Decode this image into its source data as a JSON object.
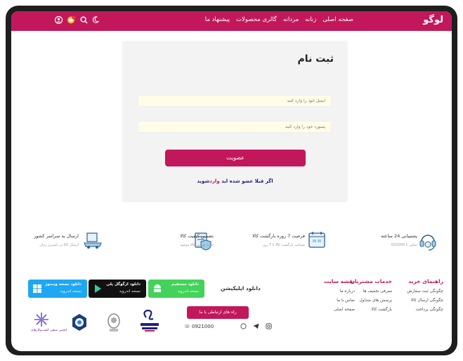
{
  "header": {
    "logo": "لوگو",
    "nav": [
      "صفحه اصلی",
      "زنانه",
      "مردانه",
      "گالری محصولات",
      "پیشنهاد ما"
    ],
    "icons": [
      "user-icon",
      "cart-icon",
      "search-icon",
      "moon-icon"
    ],
    "color": "#c2185b"
  },
  "register": {
    "title": "ثبت نام",
    "email_placeholder": "ایمیل خود را وارد کنید",
    "password_placeholder": "پسورد خود را وارد کنید",
    "submit": "عضویت",
    "login_prefix": "اگر قبلا عضو شده اید",
    "login_link": "وارد",
    "login_suffix": "شوید"
  },
  "features": [
    {
      "title": "پشتیبانی 24 ساعته",
      "subtitle": "تماس با 021000",
      "icon": "headset-icon"
    },
    {
      "title": "فرصت 7 روزه بازگشت کالا",
      "subtitle": "ضمانت بازگشت کالا تا 7 روز",
      "icon": "calendar-icon"
    },
    {
      "title": "تضمین کیفیت کالا",
      "subtitle": "خرید بهترین کالا موجود",
      "icon": "quality-shield-icon"
    },
    {
      "title": "ارسال به سراسر کشور",
      "subtitle": "ارسال کالا در کمترین زمان",
      "icon": "delivery-icon"
    }
  ],
  "footer": {
    "guide": {
      "title": "راهنمای خرید",
      "items": [
        "چگونگی ثبت سفارش",
        "چگونگی ارسال کالا",
        "چگونگی پرداخت"
      ]
    },
    "services": {
      "title": "خدمات مشتریان",
      "items": [
        "معرفی تخفیف ها",
        "پرسش های متداول",
        "بازگشت کالا"
      ]
    },
    "sitemap": {
      "title": "نقشه سایت",
      "items": [
        "درباره ما",
        "تماس با ما",
        "صفحه اصلی"
      ]
    },
    "download_title": "دانلود اپلیکیشن",
    "apps": [
      {
        "line1": "دانلود مستقیم",
        "line2": "نسخه اندروید",
        "color": "#43d35a",
        "icon": "android-icon"
      },
      {
        "line1": "دانلود ازگوگل پلی",
        "line2": "نسخه اندروید",
        "color": "#111111",
        "icon": "google-play-icon"
      },
      {
        "line1": "دانلود نسخه ویندوز",
        "line2": "نسخه اندروید",
        "color": "#1ea7f3",
        "icon": "windows-icon"
      }
    ],
    "contact_button": "راه های ارتباطی با ما",
    "phone": "0921000",
    "badge_caption": "انجمن صنفی کسب‌وکارهای"
  }
}
